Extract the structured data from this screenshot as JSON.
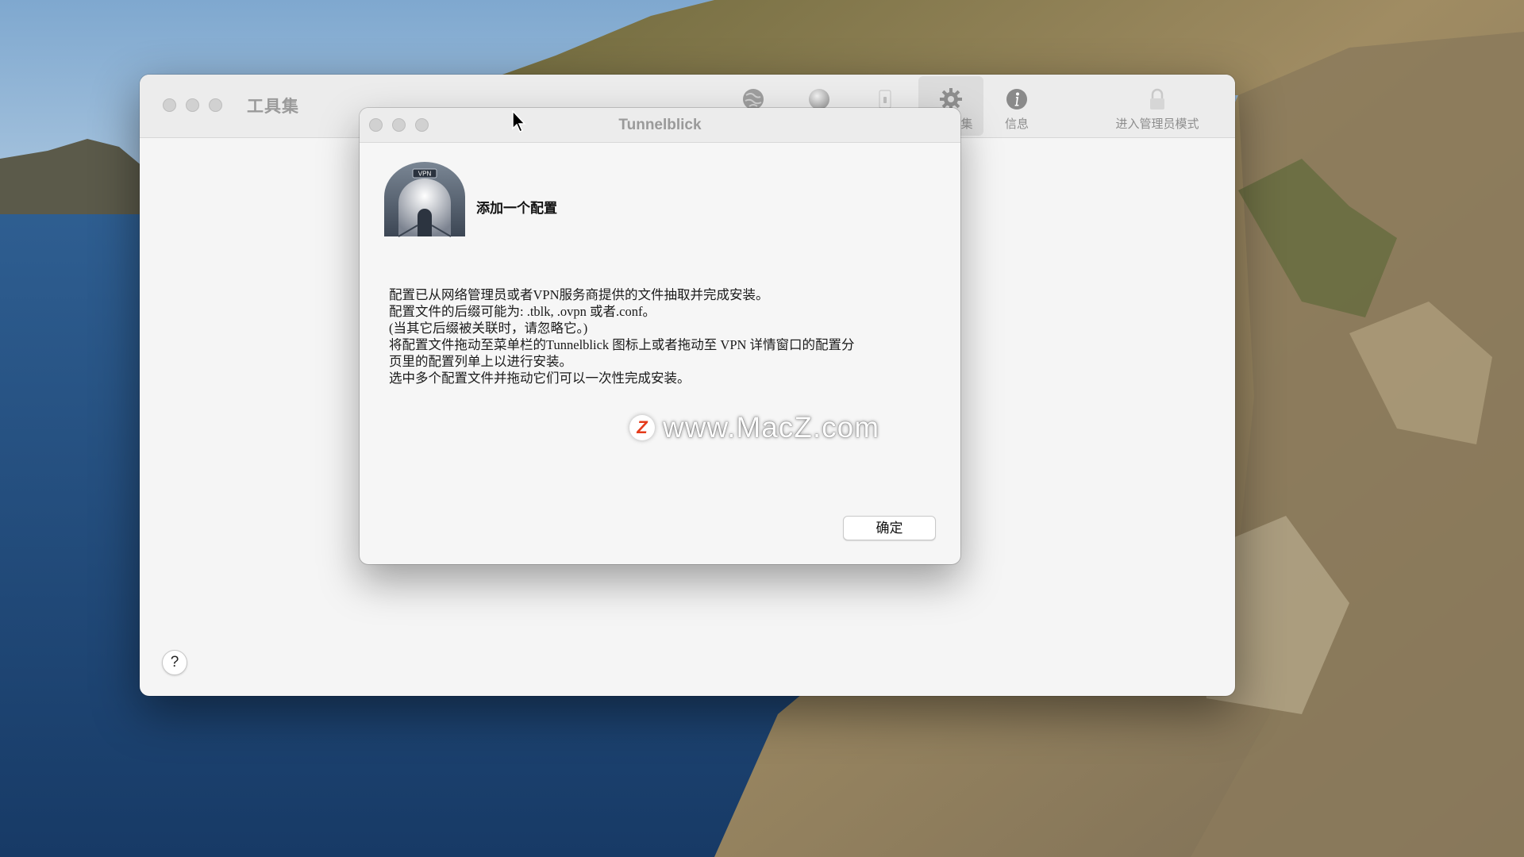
{
  "main_window": {
    "title": "工具集",
    "toolbar": [
      {
        "label": "",
        "icon": "globe-icon"
      },
      {
        "label": "",
        "icon": "sphere-icon"
      },
      {
        "label": "",
        "icon": "switch-icon"
      },
      {
        "label": "集",
        "icon": "gear-icon",
        "active": true
      },
      {
        "label": "信息",
        "icon": "info-icon"
      },
      {
        "label": "进入管理员模式",
        "icon": "lock-icon"
      }
    ],
    "help_label": "?"
  },
  "dialog": {
    "title": "Tunnelblick",
    "logo_text": "VPN",
    "heading": "添加一个配置",
    "body_lines": [
      "配置已从网络管理员或者VPN服务商提供的文件抽取并完成安装。",
      "配置文件的后缀可能为: .tblk, .ovpn 或者.conf。",
      "(当其它后缀被关联时，请忽略它。)",
      "将配置文件拖动至菜单栏的Tunnelblick 图标上或者拖动至 VPN 详情窗口的配置分",
      "页里的配置列单上以进行安装。",
      "选中多个配置文件并拖动它们可以一次性完成安装。"
    ],
    "ok_label": "确定"
  },
  "watermark": {
    "logo_letter": "Z",
    "text": "www.MacZ.com"
  }
}
